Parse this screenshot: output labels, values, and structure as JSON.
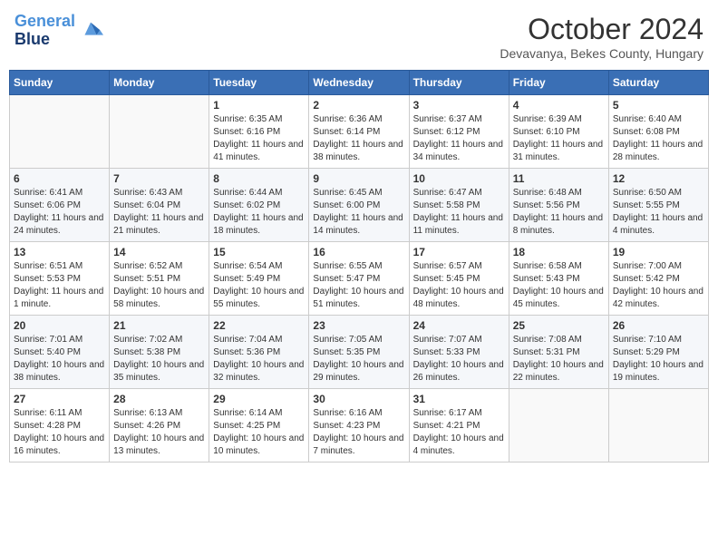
{
  "logo": {
    "line1": "General",
    "line2": "Blue"
  },
  "title": "October 2024",
  "location": "Devavanya, Bekes County, Hungary",
  "days_of_week": [
    "Sunday",
    "Monday",
    "Tuesday",
    "Wednesday",
    "Thursday",
    "Friday",
    "Saturday"
  ],
  "weeks": [
    [
      {
        "day": "",
        "info": ""
      },
      {
        "day": "",
        "info": ""
      },
      {
        "day": "1",
        "info": "Sunrise: 6:35 AM\nSunset: 6:16 PM\nDaylight: 11 hours and 41 minutes."
      },
      {
        "day": "2",
        "info": "Sunrise: 6:36 AM\nSunset: 6:14 PM\nDaylight: 11 hours and 38 minutes."
      },
      {
        "day": "3",
        "info": "Sunrise: 6:37 AM\nSunset: 6:12 PM\nDaylight: 11 hours and 34 minutes."
      },
      {
        "day": "4",
        "info": "Sunrise: 6:39 AM\nSunset: 6:10 PM\nDaylight: 11 hours and 31 minutes."
      },
      {
        "day": "5",
        "info": "Sunrise: 6:40 AM\nSunset: 6:08 PM\nDaylight: 11 hours and 28 minutes."
      }
    ],
    [
      {
        "day": "6",
        "info": "Sunrise: 6:41 AM\nSunset: 6:06 PM\nDaylight: 11 hours and 24 minutes."
      },
      {
        "day": "7",
        "info": "Sunrise: 6:43 AM\nSunset: 6:04 PM\nDaylight: 11 hours and 21 minutes."
      },
      {
        "day": "8",
        "info": "Sunrise: 6:44 AM\nSunset: 6:02 PM\nDaylight: 11 hours and 18 minutes."
      },
      {
        "day": "9",
        "info": "Sunrise: 6:45 AM\nSunset: 6:00 PM\nDaylight: 11 hours and 14 minutes."
      },
      {
        "day": "10",
        "info": "Sunrise: 6:47 AM\nSunset: 5:58 PM\nDaylight: 11 hours and 11 minutes."
      },
      {
        "day": "11",
        "info": "Sunrise: 6:48 AM\nSunset: 5:56 PM\nDaylight: 11 hours and 8 minutes."
      },
      {
        "day": "12",
        "info": "Sunrise: 6:50 AM\nSunset: 5:55 PM\nDaylight: 11 hours and 4 minutes."
      }
    ],
    [
      {
        "day": "13",
        "info": "Sunrise: 6:51 AM\nSunset: 5:53 PM\nDaylight: 11 hours and 1 minute."
      },
      {
        "day": "14",
        "info": "Sunrise: 6:52 AM\nSunset: 5:51 PM\nDaylight: 10 hours and 58 minutes."
      },
      {
        "day": "15",
        "info": "Sunrise: 6:54 AM\nSunset: 5:49 PM\nDaylight: 10 hours and 55 minutes."
      },
      {
        "day": "16",
        "info": "Sunrise: 6:55 AM\nSunset: 5:47 PM\nDaylight: 10 hours and 51 minutes."
      },
      {
        "day": "17",
        "info": "Sunrise: 6:57 AM\nSunset: 5:45 PM\nDaylight: 10 hours and 48 minutes."
      },
      {
        "day": "18",
        "info": "Sunrise: 6:58 AM\nSunset: 5:43 PM\nDaylight: 10 hours and 45 minutes."
      },
      {
        "day": "19",
        "info": "Sunrise: 7:00 AM\nSunset: 5:42 PM\nDaylight: 10 hours and 42 minutes."
      }
    ],
    [
      {
        "day": "20",
        "info": "Sunrise: 7:01 AM\nSunset: 5:40 PM\nDaylight: 10 hours and 38 minutes."
      },
      {
        "day": "21",
        "info": "Sunrise: 7:02 AM\nSunset: 5:38 PM\nDaylight: 10 hours and 35 minutes."
      },
      {
        "day": "22",
        "info": "Sunrise: 7:04 AM\nSunset: 5:36 PM\nDaylight: 10 hours and 32 minutes."
      },
      {
        "day": "23",
        "info": "Sunrise: 7:05 AM\nSunset: 5:35 PM\nDaylight: 10 hours and 29 minutes."
      },
      {
        "day": "24",
        "info": "Sunrise: 7:07 AM\nSunset: 5:33 PM\nDaylight: 10 hours and 26 minutes."
      },
      {
        "day": "25",
        "info": "Sunrise: 7:08 AM\nSunset: 5:31 PM\nDaylight: 10 hours and 22 minutes."
      },
      {
        "day": "26",
        "info": "Sunrise: 7:10 AM\nSunset: 5:29 PM\nDaylight: 10 hours and 19 minutes."
      }
    ],
    [
      {
        "day": "27",
        "info": "Sunrise: 6:11 AM\nSunset: 4:28 PM\nDaylight: 10 hours and 16 minutes."
      },
      {
        "day": "28",
        "info": "Sunrise: 6:13 AM\nSunset: 4:26 PM\nDaylight: 10 hours and 13 minutes."
      },
      {
        "day": "29",
        "info": "Sunrise: 6:14 AM\nSunset: 4:25 PM\nDaylight: 10 hours and 10 minutes."
      },
      {
        "day": "30",
        "info": "Sunrise: 6:16 AM\nSunset: 4:23 PM\nDaylight: 10 hours and 7 minutes."
      },
      {
        "day": "31",
        "info": "Sunrise: 6:17 AM\nSunset: 4:21 PM\nDaylight: 10 hours and 4 minutes."
      },
      {
        "day": "",
        "info": ""
      },
      {
        "day": "",
        "info": ""
      }
    ]
  ]
}
